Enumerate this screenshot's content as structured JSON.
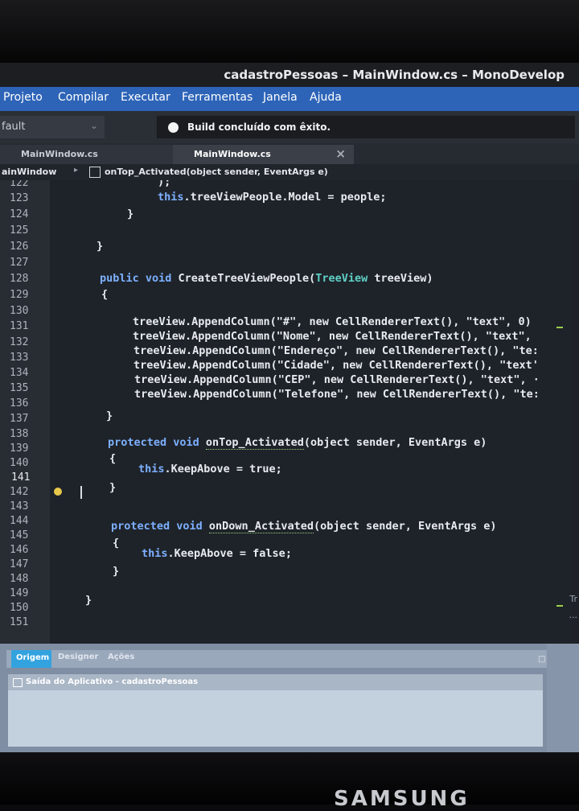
{
  "window": {
    "title": "cadastroPessoas – MainWindow.cs – MonoDevelop"
  },
  "menu": [
    {
      "label": "Projeto"
    },
    {
      "label": "Compilar"
    },
    {
      "label": "Executar"
    },
    {
      "label": "Ferramentas"
    },
    {
      "label": "Janela"
    },
    {
      "label": "Ajuda"
    }
  ],
  "toolbar": {
    "config_value": "fault",
    "status_text": "Build concluído com êxito."
  },
  "tabs": [
    {
      "label": "MainWindow.cs"
    },
    {
      "label": "MainWindow.cs"
    }
  ],
  "breadcrumb": {
    "class": "ainWindow",
    "method": "onTop_Activated(object sender, EventArgs e)"
  },
  "editor": {
    "line_numbers": [
      "122",
      "123",
      "124",
      "125",
      "126",
      "127",
      "128",
      "129",
      "130",
      "131",
      "132",
      "133",
      "134",
      "135",
      "136",
      "137",
      "138",
      "139",
      "140",
      "141",
      "142",
      "143",
      "144",
      "145",
      "146",
      "147",
      "148",
      "149",
      "150",
      "151"
    ],
    "code": {
      "l122": ");",
      "l123_a": "this",
      "l123_b": ".treeViewPeople.Model = people;",
      "l124": "}",
      "l126": "}",
      "l128_kw": "public void ",
      "l128_name": "CreateTreeViewPeople(",
      "l128_type": "TreeView",
      "l128_rest": " treeView)",
      "l129": "{",
      "l131": "treeView.AppendColumn(\"#\", new CellRendererText(), \"text\", 0)",
      "l132": "treeView.AppendColumn(\"Nome\", new CellRendererText(), \"text\",",
      "l133": "treeView.AppendColumn(\"Endereço\", new CellRendererText(), \"te:",
      "l134": "treeView.AppendColumn(\"Cidade\", new CellRendererText(), \"text'",
      "l135": "treeView.AppendColumn(\"CEP\", new CellRendererText(), \"text\", ·",
      "l136": "treeView.AppendColumn(\"Telefone\", new CellRendererText(), \"te:",
      "l137": "}",
      "l139_kw": "protected void ",
      "l139_name": "onTop_Activated",
      "l139_rest": "(object sender, EventArgs e)",
      "l140": "{",
      "l141_a": "this",
      "l141_b": ".KeepAbove = true;",
      "l142": "}",
      "l145_kw": "protected void ",
      "l145_name": "onDown_Activated",
      "l145_rest": "(object sender, EventArgs e)",
      "l146": "{",
      "l147_a": "this",
      "l147_b": ".KeepAbove = false;",
      "l148": "}",
      "l150": "}"
    }
  },
  "bottom_panel": {
    "tabs": [
      {
        "label": "Origem"
      },
      {
        "label": "Designer"
      },
      {
        "label": "Ações"
      }
    ],
    "output_title": "Saída do Aplicativo - cadastroPessoas",
    "close_glyph": "□ ×"
  },
  "right_fragments": [
    "Tr",
    "..."
  ],
  "device_brand": "SAMSUNG",
  "colors": {
    "menubar": "#2d64b8",
    "editor_bg": "#1e2329",
    "keyword": "#7db0ff",
    "type": "#5fd0c6",
    "active_tab": "#33a3e0"
  }
}
